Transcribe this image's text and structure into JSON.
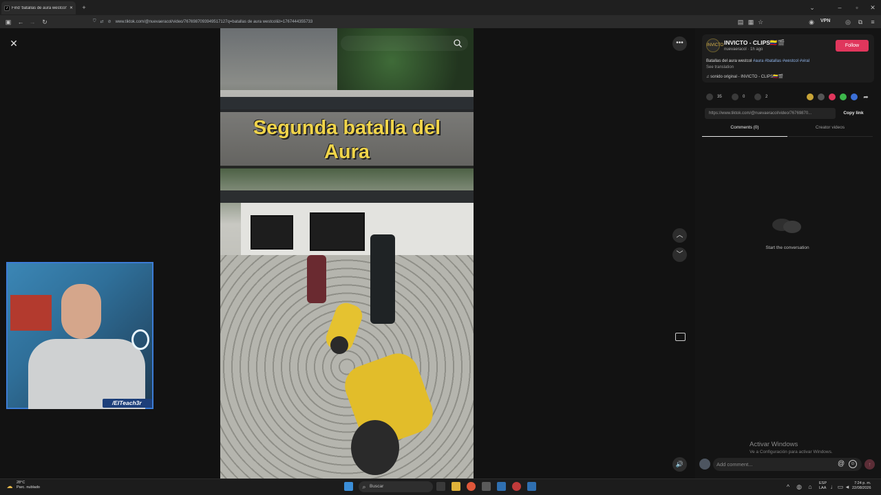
{
  "browser": {
    "tab_title": "Find 'batallas de aura westcol' o",
    "url": "www.tiktok.com/@nuevaeracol/video/7676987093949517127q=batallas de aura westcol&t=1767444355733",
    "vpn_label": "VPN"
  },
  "video": {
    "caption_line1": "Segunda batalla del",
    "caption_line2": "Aura"
  },
  "post": {
    "avatar_text": "INVICTO",
    "author": "INVICTO - CLIPS🇨🇴🎬",
    "handle": "nuevaeracol · 1h ago",
    "follow_label": "Follow",
    "description": "Batallas del aura westcol",
    "hashtags": "#aura #batallas #westcol #viral",
    "see_translation": "See translation",
    "sound": "♫  sonido original - INVICTO - CLIPS🇨🇴🎬",
    "likes": "35",
    "comments": "0",
    "saves": "2",
    "link": "https://www.tiktok.com/@nuevaeracol/video/76769870...",
    "copy_label": "Copy link",
    "tab_comments": "Comments (0)",
    "tab_creator": "Creator videos",
    "empty_text": "Start the conversation",
    "comment_placeholder": "Add comment..."
  },
  "watermark": {
    "line1": "Activar Windows",
    "line2": "Ve a Configuración para activar Windows."
  },
  "webcam": {
    "tag": "/ElTeach3r"
  },
  "taskbar": {
    "temp": "28°C",
    "weather": "Parc. nublado",
    "search": "Buscar",
    "lang1": "ESP",
    "lang2": "LAA",
    "time": "7:24 p. m.",
    "date": "22/08/2026"
  },
  "colors": {
    "follow": "#e0365c",
    "webcam_border": "#3c7cd6",
    "caption": "#f0d44a"
  }
}
